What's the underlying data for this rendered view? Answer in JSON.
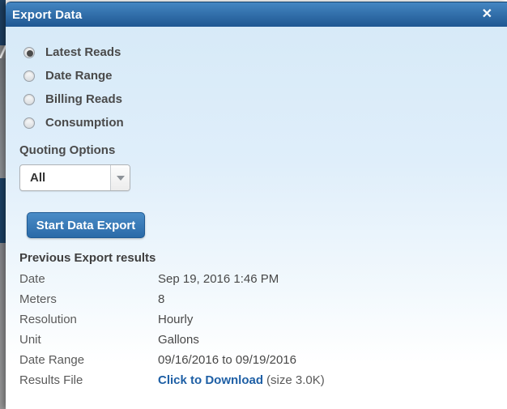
{
  "modal": {
    "title": "Export Data"
  },
  "icons": {
    "close": "✕"
  },
  "options": {
    "items": [
      {
        "label": "Latest Reads",
        "selected": true
      },
      {
        "label": "Date Range",
        "selected": false
      },
      {
        "label": "Billing Reads",
        "selected": false
      },
      {
        "label": "Consumption",
        "selected": false
      }
    ],
    "quoting_label": "Quoting Options",
    "quoting_selected_value": "All"
  },
  "actions": {
    "start_export_label": "Start Data Export"
  },
  "previous_results": {
    "heading": "Previous Export results",
    "rows": [
      {
        "label": "Date",
        "value": "Sep 19, 2016 1:46 PM"
      },
      {
        "label": "Meters",
        "value": "8"
      },
      {
        "label": "Resolution",
        "value": "Hourly"
      },
      {
        "label": "Unit",
        "value": "Gallons"
      },
      {
        "label": "Date Range",
        "value": "09/16/2016 to 09/19/2016"
      },
      {
        "label": "Results File",
        "link": "Click to Download",
        "suffix": "(size 3.0K)"
      }
    ]
  },
  "colors": {
    "header_gradient_top": "#4486c2",
    "header_gradient_bottom": "#1f5792",
    "body_background_top": "#d7eaf8",
    "button_gradient_top": "#4a8cc7",
    "button_gradient_bottom": "#2a6aa8",
    "link_blue": "#1e5fa5",
    "text_dark_gray": "#4a4a4a"
  }
}
